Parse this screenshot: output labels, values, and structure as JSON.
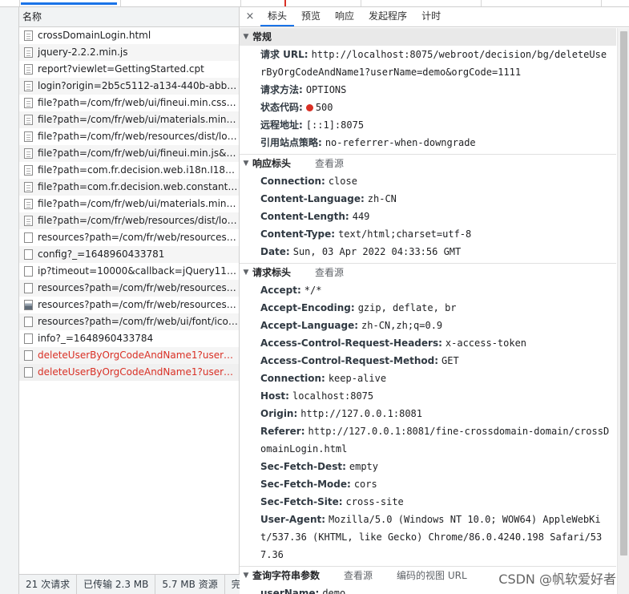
{
  "list": {
    "header": "名称",
    "rows": [
      {
        "name": "crossDomainLogin.html",
        "error": false,
        "icon": "doc"
      },
      {
        "name": "jquery-2.2.2.min.js",
        "error": false,
        "icon": "doc"
      },
      {
        "name": "report?viewlet=GettingStarted.cpt",
        "error": false,
        "icon": "doc"
      },
      {
        "name": "login?origin=2b5c5112-a134-440b-abb8-d1...",
        "error": false,
        "icon": "doc"
      },
      {
        "name": "file?path=/com/fr/web/ui/fineui.min.css&typ...",
        "error": false,
        "icon": "doc"
      },
      {
        "name": "file?path=/com/fr/web/ui/materials.min.css&...",
        "error": false,
        "icon": "doc"
      },
      {
        "name": "file?path=/com/fr/web/resources/dist/login....",
        "error": false,
        "icon": "doc"
      },
      {
        "name": "file?path=/com/fr/web/ui/fineui.min.js&type...",
        "error": false,
        "icon": "doc"
      },
      {
        "name": "file?path=com.fr.decision.web.i18n.I18nTextG...",
        "error": false,
        "icon": "doc"
      },
      {
        "name": "file?path=com.fr.decision.web.constant.Cons...",
        "error": false,
        "icon": "doc"
      },
      {
        "name": "file?path=/com/fr/web/ui/materials.min.js&t...",
        "error": false,
        "icon": "doc"
      },
      {
        "name": "file?path=/com/fr/web/resources/dist/login....",
        "error": false,
        "icon": "doc"
      },
      {
        "name": "resources?path=/com/fr/web/resources/dist...",
        "error": false,
        "icon": "blank"
      },
      {
        "name": "config?_=1648960433781",
        "error": false,
        "icon": "blank"
      },
      {
        "name": "ip?timeout=10000&callback=jQuery1124047...",
        "error": false,
        "icon": "blank"
      },
      {
        "name": "resources?path=/com/fr/web/resources/dist...",
        "error": false,
        "icon": "blank"
      },
      {
        "name": "resources?path=/com/fr/web/resources/dist...",
        "error": false,
        "icon": "img"
      },
      {
        "name": "resources?path=/com/fr/web/ui/font/iconfo...",
        "error": false,
        "icon": "blank"
      },
      {
        "name": "info?_=1648960433784",
        "error": false,
        "icon": "blank"
      },
      {
        "name": "deleteUserByOrgCodeAndName1?userName...",
        "error": true,
        "icon": "blank"
      },
      {
        "name": "deleteUserByOrgCodeAndName1?userName...",
        "error": true,
        "icon": "blank"
      }
    ],
    "status": {
      "requests": "21 次请求",
      "transferred": "已传输 2.3 MB",
      "resources": "5.7 MB 资源",
      "finish": "完"
    }
  },
  "tabs": {
    "close": "×",
    "items": [
      "标头",
      "预览",
      "响应",
      "发起程序",
      "计时"
    ]
  },
  "general": {
    "title": "常规",
    "url_k": "请求 URL:",
    "url_v": "http://localhost:8075/webroot/decision/bg/deleteUserByOrgCodeAndName1?userName=demo&orgCode=1111",
    "method_k": "请求方法:",
    "method_v": "OPTIONS",
    "status_k": "状态代码:",
    "status_v": "500",
    "remote_k": "远程地址:",
    "remote_v": "[::1]:8075",
    "policy_k": "引用站点策略:",
    "policy_v": "no-referrer-when-downgrade"
  },
  "response_headers": {
    "title": "响应标头",
    "view_source": "查看源",
    "items": [
      {
        "k": "Connection:",
        "v": "close"
      },
      {
        "k": "Content-Language:",
        "v": "zh-CN"
      },
      {
        "k": "Content-Length:",
        "v": "449"
      },
      {
        "k": "Content-Type:",
        "v": "text/html;charset=utf-8"
      },
      {
        "k": "Date:",
        "v": "Sun, 03 Apr 2022 04:33:56 GMT"
      }
    ]
  },
  "request_headers": {
    "title": "请求标头",
    "view_source": "查看源",
    "items": [
      {
        "k": "Accept:",
        "v": "*/*"
      },
      {
        "k": "Accept-Encoding:",
        "v": "gzip, deflate, br"
      },
      {
        "k": "Accept-Language:",
        "v": "zh-CN,zh;q=0.9"
      },
      {
        "k": "Access-Control-Request-Headers:",
        "v": "x-access-token"
      },
      {
        "k": "Access-Control-Request-Method:",
        "v": "GET"
      },
      {
        "k": "Connection:",
        "v": "keep-alive"
      },
      {
        "k": "Host:",
        "v": "localhost:8075"
      },
      {
        "k": "Origin:",
        "v": "http://127.0.0.1:8081"
      },
      {
        "k": "Referer:",
        "v": "http://127.0.0.1:8081/fine-crossdomain-domain/crossDomainLogin.html"
      },
      {
        "k": "Sec-Fetch-Dest:",
        "v": "empty"
      },
      {
        "k": "Sec-Fetch-Mode:",
        "v": "cors"
      },
      {
        "k": "Sec-Fetch-Site:",
        "v": "cross-site"
      },
      {
        "k": "User-Agent:",
        "v": "Mozilla/5.0 (Windows NT 10.0; WOW64) AppleWebKit/537.36 (KHTML, like Gecko) Chrome/86.0.4240.198 Safari/537.36"
      }
    ]
  },
  "query_params": {
    "title": "查询字符串参数",
    "view_source": "查看源",
    "view_decoded": "编码的视图 URL",
    "first_k": "userName:",
    "first_v": "demo"
  },
  "watermark": "CSDN @帆软爱好者",
  "colors": {
    "accent": "#1a73e8",
    "error": "#d93025"
  }
}
